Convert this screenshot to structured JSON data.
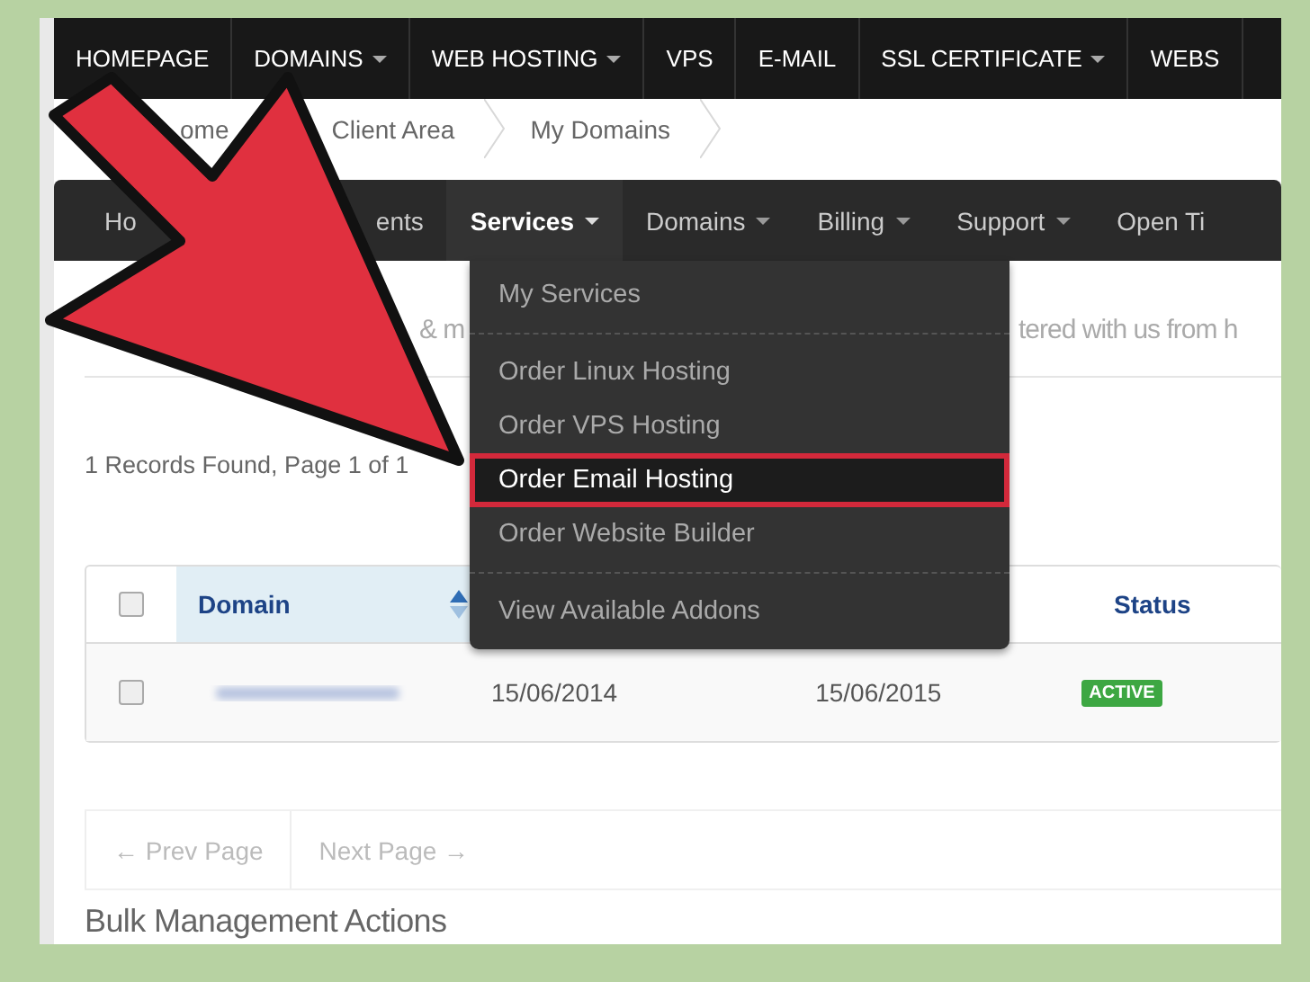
{
  "top_nav": [
    {
      "label": "HOMEPAGE",
      "dropdown": false
    },
    {
      "label": "DOMAINS",
      "dropdown": true
    },
    {
      "label": "WEB HOSTING",
      "dropdown": true
    },
    {
      "label": "VPS",
      "dropdown": false
    },
    {
      "label": "E-MAIL",
      "dropdown": false
    },
    {
      "label": "SSL CERTIFICATE",
      "dropdown": true
    },
    {
      "label": "WEBS",
      "dropdown": false
    }
  ],
  "breadcrumb": [
    "ome",
    "Client Area",
    "My Domains"
  ],
  "client_nav": [
    {
      "label": "Ho",
      "dropdown": false,
      "selected": false
    },
    {
      "label": "ents",
      "dropdown": false,
      "selected": false
    },
    {
      "label": "Services",
      "dropdown": true,
      "selected": true
    },
    {
      "label": "Domains",
      "dropdown": true,
      "selected": false
    },
    {
      "label": "Billing",
      "dropdown": true,
      "selected": false
    },
    {
      "label": "Support",
      "dropdown": true,
      "selected": false
    },
    {
      "label": "Open Ti",
      "dropdown": false,
      "selected": false
    }
  ],
  "services_menu": [
    {
      "kind": "item",
      "label": "My Services",
      "selected": false
    },
    {
      "kind": "divider"
    },
    {
      "kind": "item",
      "label": "Order Linux Hosting",
      "selected": false
    },
    {
      "kind": "item",
      "label": "Order VPS Hosting",
      "selected": false
    },
    {
      "kind": "item",
      "label": "Order Email Hosting",
      "selected": true
    },
    {
      "kind": "item",
      "label": "Order Website Builder",
      "selected": false
    },
    {
      "kind": "divider"
    },
    {
      "kind": "item",
      "label": "View Available Addons",
      "selected": false
    }
  ],
  "intro_fragments": [
    "& m",
    "tered with us from h"
  ],
  "records": "1 Records Found, Page 1 of 1",
  "table": {
    "columns": [
      {
        "label": "Domain",
        "sorted": true
      },
      {
        "label": "Status"
      }
    ],
    "header_checked": false,
    "rows": [
      {
        "checked": false,
        "registered": "15/06/2014",
        "expires": "15/06/2015",
        "status": "ACTIVE"
      }
    ]
  },
  "pagination": {
    "prev": "← Prev Page",
    "next": "Next Page →"
  },
  "bulk_title": "Bulk Management Actions"
}
